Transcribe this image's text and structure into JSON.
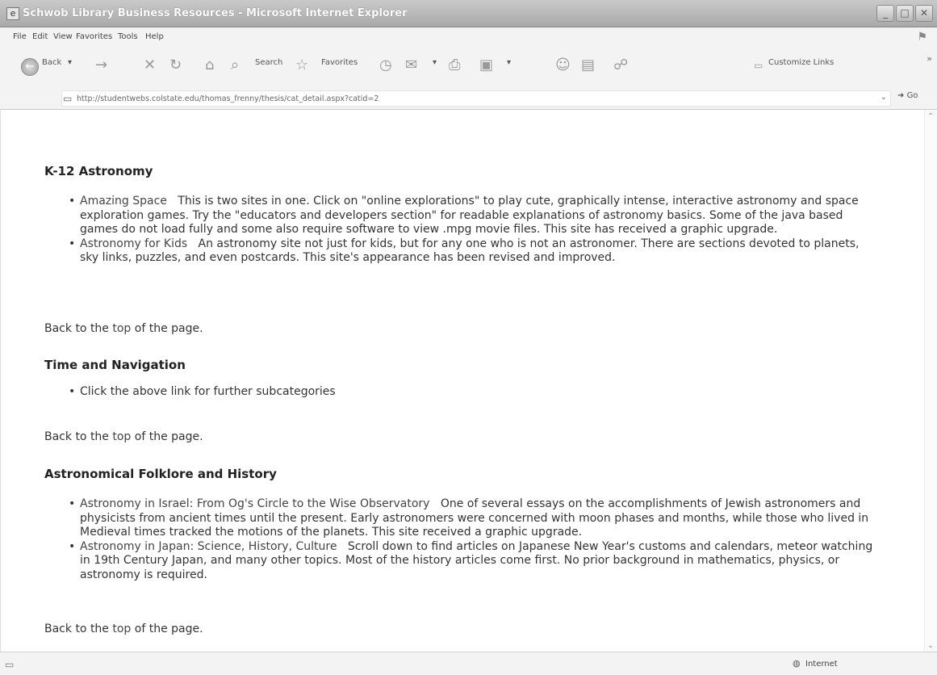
{
  "window": {
    "title": "Schwob Library Business Resources - Microsoft Internet Explorer"
  },
  "menu": [
    "File",
    "Edit",
    "View",
    "Favorites",
    "Tools",
    "Help"
  ],
  "toolbar": {
    "back_label": "Back",
    "search_label": "Search",
    "favorites_label": "Favorites",
    "customize_links_label": "Customize Links"
  },
  "address": {
    "url": "http://studentwebs.colstate.edu/thomas_frenny/thesis/cat_detail.aspx?catid=2",
    "go_label": "Go"
  },
  "sections": [
    {
      "heading": "K-12 Astronomy",
      "items": [
        {
          "link": "Amazing Space",
          "text": "This is two sites in one. Click on \"online explorations\" to play cute, graphically intense, interactive astronomy and space exploration games. Try the \"educators and developers section\" for readable explanations of astronomy basics. Some of the java based games do not load fully and some also require software to view .mpg movie files. This site has received a graphic upgrade."
        },
        {
          "link": "Astronomy for Kids",
          "text": "An astronomy site not just for kids, but for any one who is not an astronomer. There are sections devoted to planets, sky links, puzzles, and even postcards. This site's appearance has been revised and improved."
        }
      ]
    },
    {
      "heading": "Time and Navigation",
      "items": [
        {
          "link": "",
          "text": "Click the above link for further subcategories"
        }
      ]
    },
    {
      "heading": "Astronomical Folklore and History",
      "items": [
        {
          "link": "Astronomy in Israel: From Og's Circle to the Wise Observatory",
          "text": "One of several essays on the accomplishments of Jewish astronomers and physicists from ancient times until the present. Early astronomers were concerned with moon phases and months, while those who lived in Medieval times tracked the motions of the planets. This site received a graphic upgrade."
        },
        {
          "link": "Astronomy in Japan: Science, History, Culture",
          "text": "Scroll down to find articles on Japanese New Year's customs and calendars, meteor watching in 19th Century Japan, and many other topics. Most of the history articles come first. No prior background in mathematics, physics, or astronomy is required."
        }
      ]
    }
  ],
  "back_to_top": {
    "before": "Back to the ",
    "link": "top",
    "after": " of the page."
  },
  "status": {
    "zone": "Internet"
  }
}
